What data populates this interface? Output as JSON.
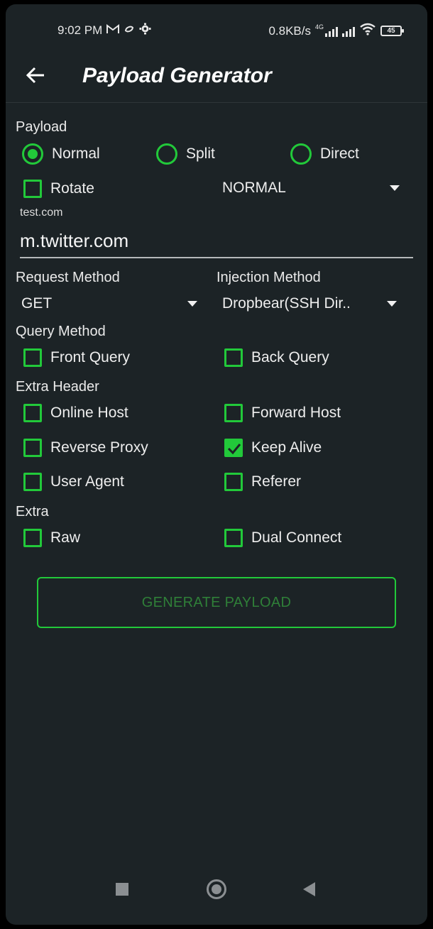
{
  "status_bar": {
    "time": "9:02 PM",
    "net_speed": "0.8KB/s",
    "network_type": "4G",
    "battery": "45",
    "icons": [
      "gmail-icon",
      "sync-icon",
      "settings-icon",
      "signal-icon",
      "wifi-icon",
      "battery-icon"
    ]
  },
  "header": {
    "title": "Payload Generator",
    "back_icon": "arrow-left-icon"
  },
  "payload": {
    "label": "Payload",
    "radios": [
      {
        "label": "Normal",
        "selected": true
      },
      {
        "label": "Split",
        "selected": false
      },
      {
        "label": "Direct",
        "selected": false
      }
    ],
    "rotate_label": "Rotate",
    "rotate_checked": false,
    "mode_select": "NORMAL",
    "host_hint": "test.com",
    "host_value": "m.twitter.com"
  },
  "methods": {
    "request_label": "Request Method",
    "request_value": "GET",
    "injection_label": "Injection Method",
    "injection_value": "Dropbear(SSH Dir.."
  },
  "query": {
    "label": "Query Method",
    "items": [
      {
        "label": "Front Query",
        "checked": false
      },
      {
        "label": "Back Query",
        "checked": false
      }
    ]
  },
  "extra_header": {
    "label": "Extra Header",
    "items": [
      {
        "label": "Online Host",
        "checked": false
      },
      {
        "label": "Forward Host",
        "checked": false
      },
      {
        "label": "Reverse Proxy",
        "checked": false
      },
      {
        "label": "Keep Alive",
        "checked": true
      },
      {
        "label": "User Agent",
        "checked": false
      },
      {
        "label": "Referer",
        "checked": false
      }
    ]
  },
  "extra": {
    "label": "Extra",
    "items": [
      {
        "label": "Raw",
        "checked": false
      },
      {
        "label": "Dual Connect",
        "checked": false
      }
    ]
  },
  "generate_button": "GENERATE PAYLOAD",
  "colors": {
    "background": "#1c2326",
    "accent": "#22c93a",
    "button_text": "#2f7f38"
  }
}
